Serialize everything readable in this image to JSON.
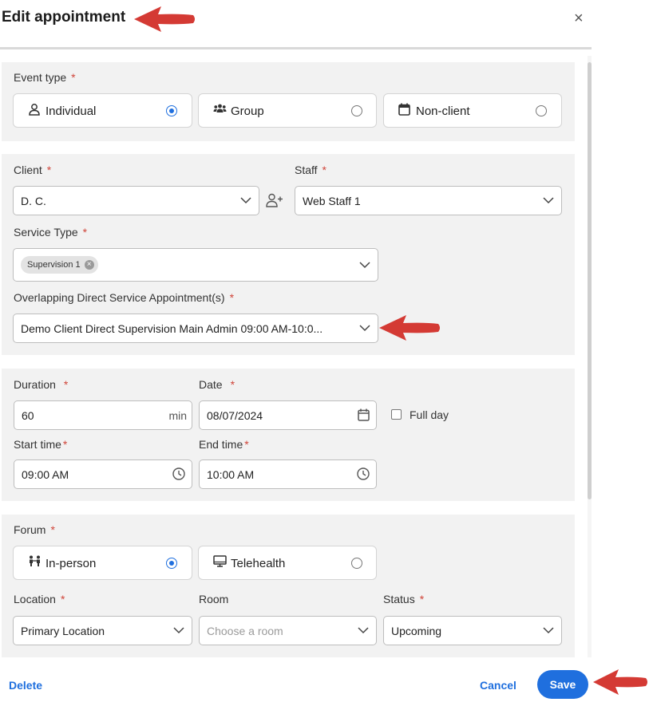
{
  "dialog": {
    "title": "Edit appointment",
    "close_glyph": "×"
  },
  "event_type": {
    "label": "Event type",
    "required": "*",
    "options": [
      {
        "label": "Individual",
        "icon": "person-icon",
        "selected": true
      },
      {
        "label": "Group",
        "icon": "group-icon",
        "selected": false
      },
      {
        "label": "Non-client",
        "icon": "calendar-icon",
        "selected": false
      }
    ]
  },
  "client": {
    "label": "Client",
    "required": "*",
    "value": "D. C."
  },
  "staff": {
    "label": "Staff",
    "required": "*",
    "value": "Web Staff 1"
  },
  "service_type": {
    "label": "Service Type",
    "required": "*",
    "chip": "Supervision 1"
  },
  "overlapping": {
    "label": "Overlapping Direct Service Appointment(s)",
    "required": "*",
    "value": "Demo Client Direct Supervision Main Admin 09:00 AM-10:0..."
  },
  "duration": {
    "label": "Duration",
    "required": "*",
    "value": "60",
    "unit": "min"
  },
  "date": {
    "label": "Date",
    "required": "*",
    "value": "08/07/2024"
  },
  "full_day": {
    "label": "Full day",
    "checked": false
  },
  "start_time": {
    "label": "Start time",
    "required": "*",
    "value": "09:00 AM"
  },
  "end_time": {
    "label": "End time",
    "required": "*",
    "value": "10:00 AM"
  },
  "forum": {
    "label": "Forum",
    "required": "*",
    "options": [
      {
        "label": "In-person",
        "icon": "in-person-icon",
        "selected": true
      },
      {
        "label": "Telehealth",
        "icon": "monitor-icon",
        "selected": false
      }
    ]
  },
  "location": {
    "label": "Location",
    "required": "*",
    "value": "Primary Location"
  },
  "room": {
    "label": "Room",
    "placeholder": "Choose a room"
  },
  "status": {
    "label": "Status",
    "required": "*",
    "value": "Upcoming"
  },
  "footer": {
    "delete": "Delete",
    "cancel": "Cancel",
    "save": "Save"
  },
  "colors": {
    "accent": "#1f6fde",
    "required": "#d0453a",
    "annotation_arrow": "#d43a34",
    "section_bg": "#f2f2f2"
  }
}
